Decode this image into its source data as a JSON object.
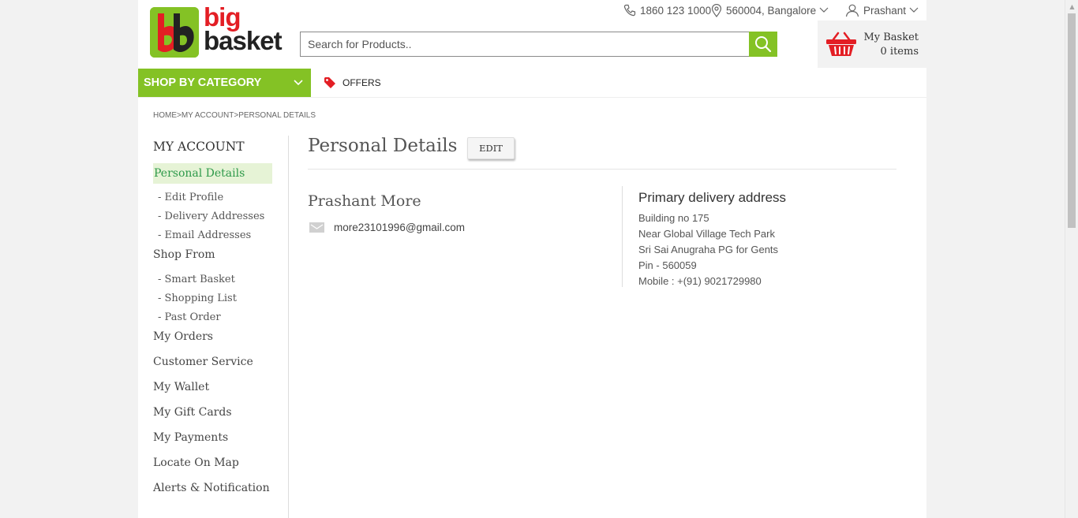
{
  "brand": {
    "big": "big",
    "basket": "basket",
    "green": "#84c225",
    "red": "#e31e24"
  },
  "topbar": {
    "phone": "1860 123 1000",
    "location": "560004, Bangalore",
    "user": "Prashant"
  },
  "search": {
    "placeholder": "Search for Products..",
    "value": ""
  },
  "basket": {
    "title": "My Basket",
    "count": "0 items"
  },
  "nav": {
    "shop_by_category": "SHOP BY CATEGORY",
    "offers": "OFFERS"
  },
  "breadcrumb": {
    "home": "HOME",
    "account": "MY ACCOUNT",
    "current": "PERSONAL DETAILS",
    "separator": ">"
  },
  "sidebar": {
    "title": "MY ACCOUNT",
    "active": "Personal Details",
    "profile_sub": [
      "- Edit Profile",
      "- Delivery Addresses",
      "- Email Addresses"
    ],
    "shop_from": "Shop From",
    "shop_sub": [
      "- Smart Basket",
      "- Shopping List",
      "- Past Order"
    ],
    "items": [
      "My Orders",
      "Customer Service",
      "My Wallet",
      "My Gift Cards",
      "My Payments",
      "Locate On Map",
      "Alerts & Notification"
    ]
  },
  "main": {
    "title": "Personal Details",
    "edit_label": "EDIT",
    "name": "Prashant More",
    "email": "more23101996@gmail.com",
    "address": {
      "title": "Primary delivery address",
      "lines": [
        "Building no 175",
        "Near Global Village Tech Park",
        "Sri Sai Anugraha PG for Gents",
        "Pin - 560059",
        "Mobile : +(91) 9021729980"
      ]
    }
  },
  "icons": {
    "phone": "phone-icon",
    "location": "location-pin-icon",
    "user": "user-icon",
    "search": "search-icon",
    "basket": "basket-icon",
    "offers": "tag-icon",
    "email": "envelope-icon"
  }
}
